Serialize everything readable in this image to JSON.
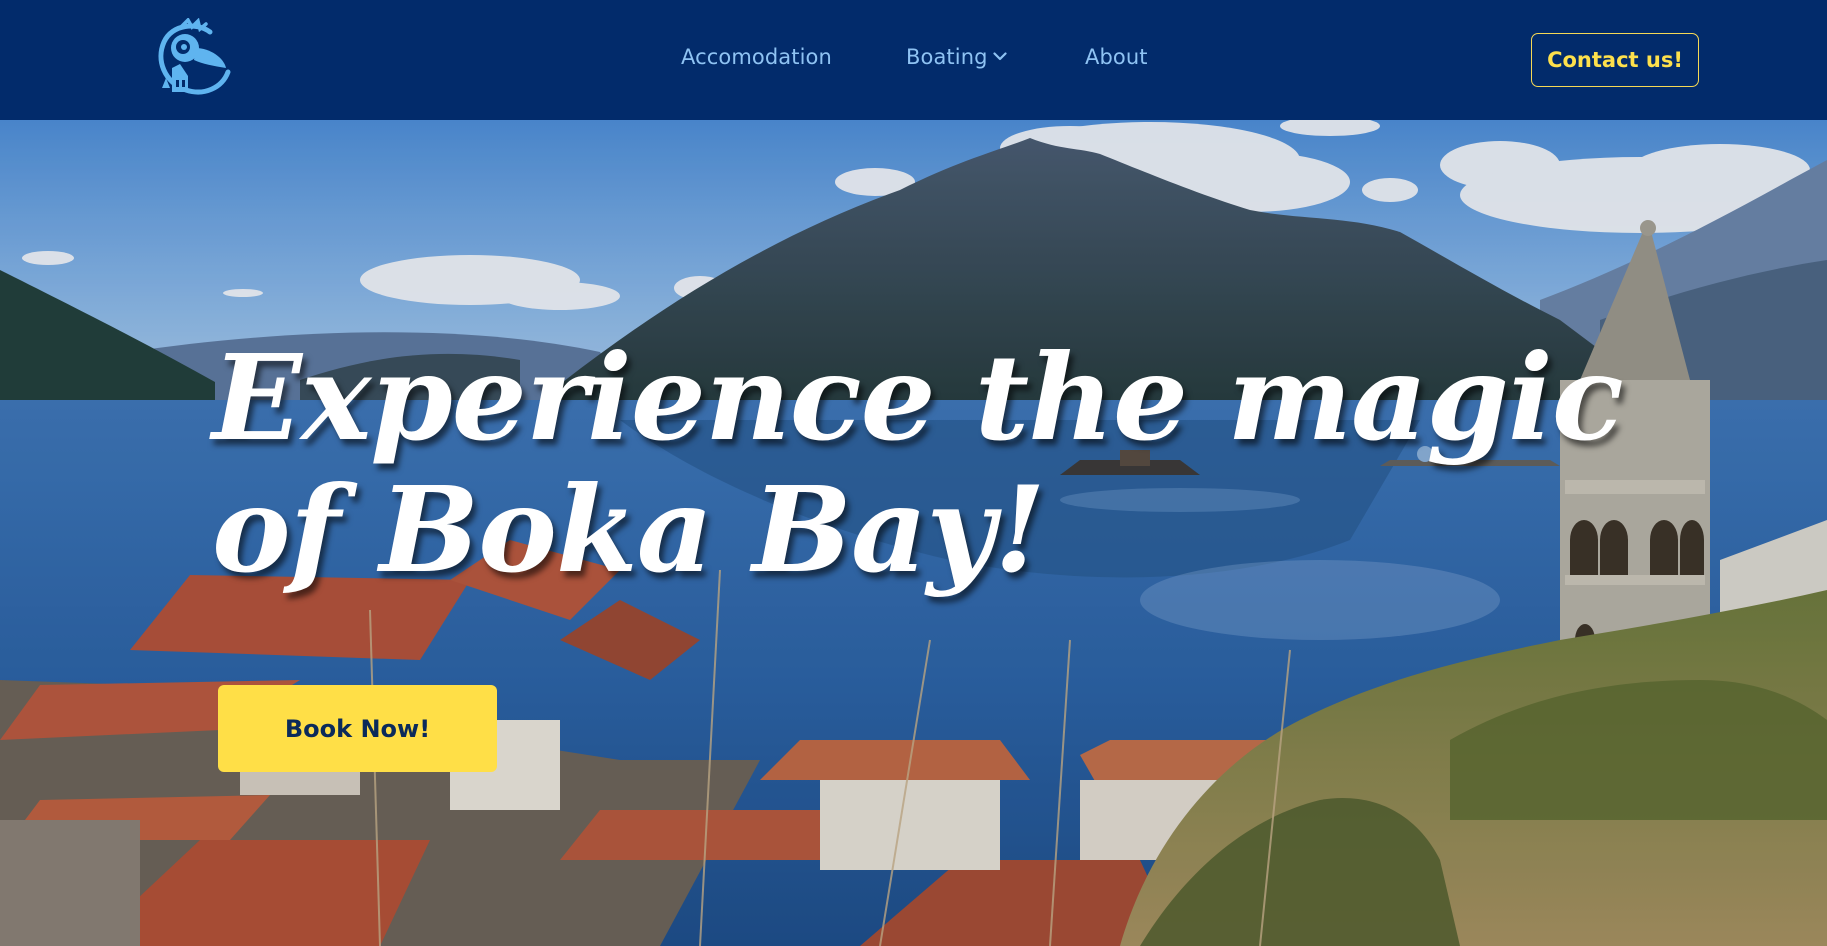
{
  "nav": {
    "logo_icon": "puffin-mascot-icon",
    "links": [
      {
        "label": "Accomodation"
      },
      {
        "label": "Boating",
        "icon": "chevron-down-icon"
      },
      {
        "label": "About"
      }
    ],
    "contact_label": "Contact us!"
  },
  "hero": {
    "title": "Experience the magic of Boka Bay!",
    "cta_label": "Book Now!"
  },
  "colors": {
    "navbar_bg": "#022b6b",
    "nav_link": "#8fc3f3",
    "accent_yellow": "#ffdf47",
    "cta_text": "#0b2a5a"
  }
}
